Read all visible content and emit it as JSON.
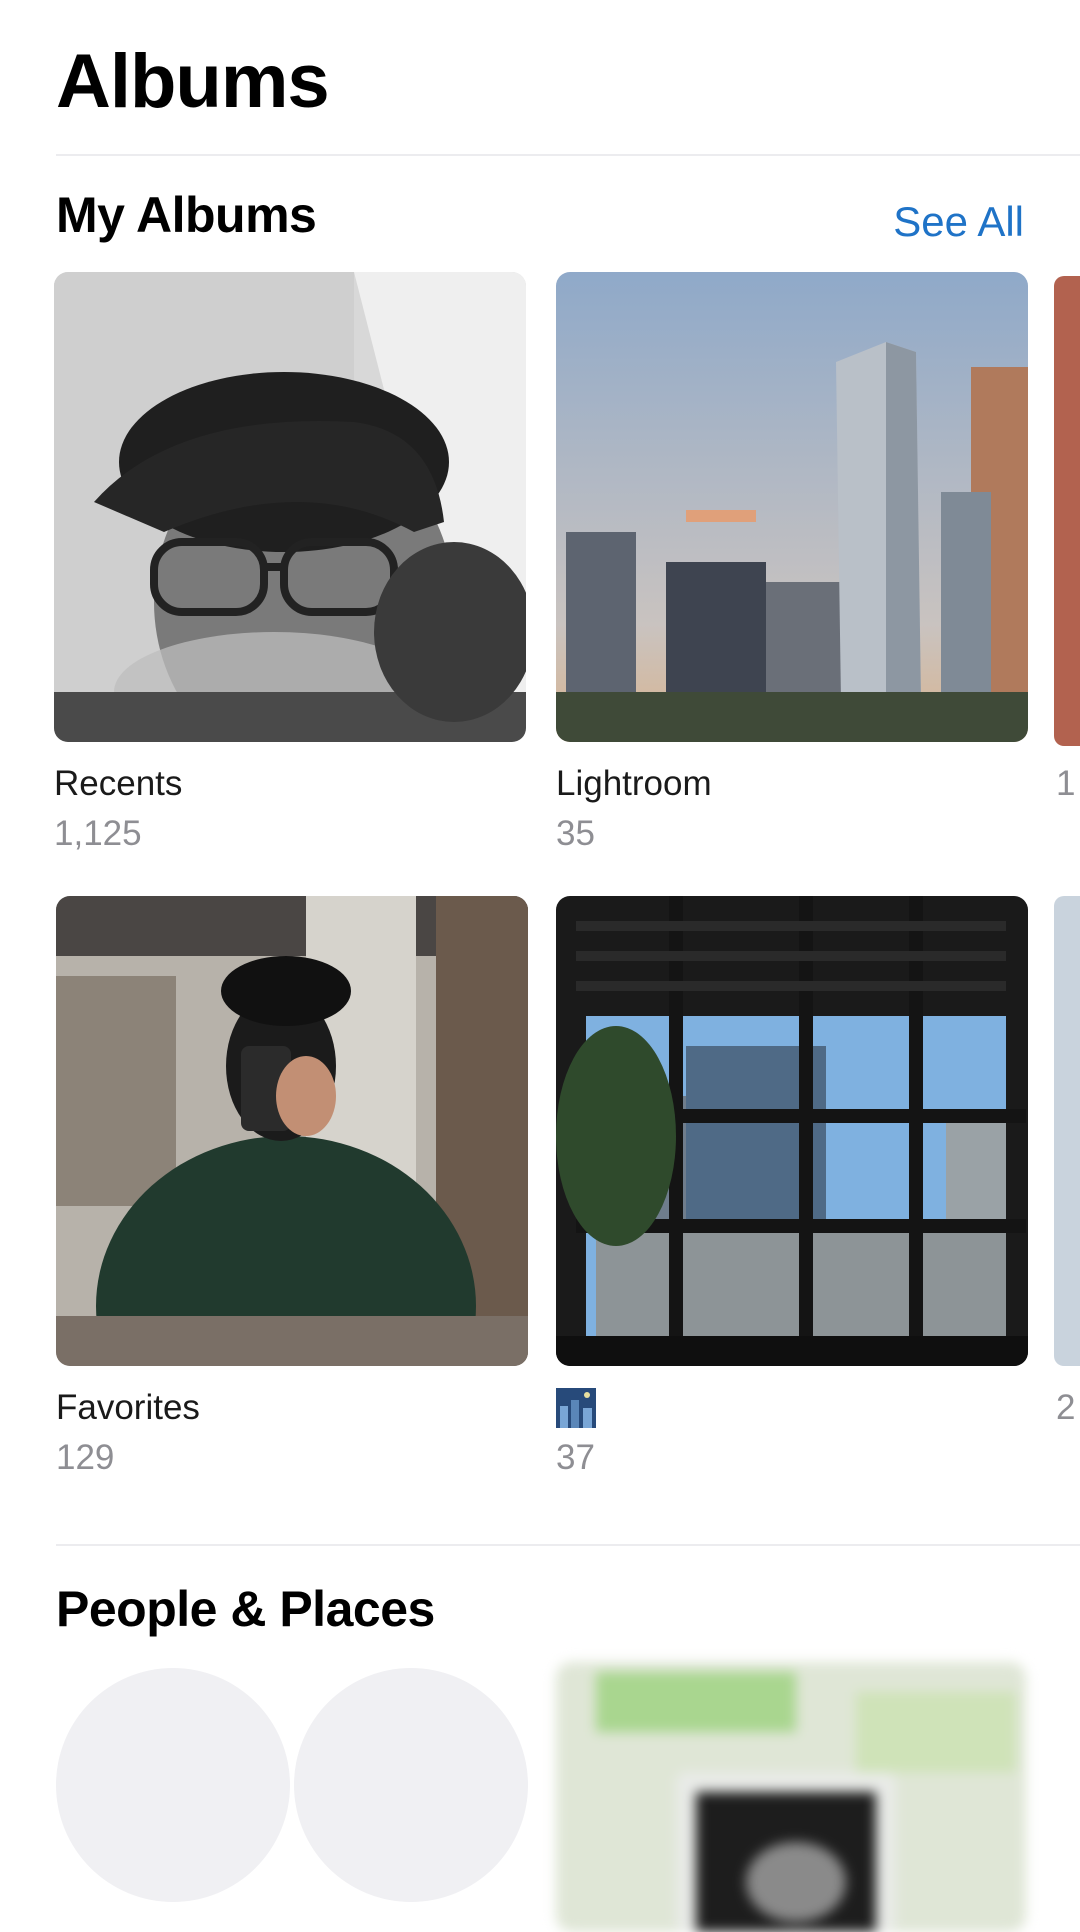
{
  "header": {
    "title": "Albums"
  },
  "my_albums": {
    "section_title": "My Albums",
    "see_all_label": "See All",
    "albums": [
      {
        "name": "Recents",
        "count": "1,125",
        "thumb_icon": "portrait-photo"
      },
      {
        "name": "Lightroom",
        "count": "35",
        "thumb_icon": "city-skyline-photo"
      },
      {
        "name": "Favorites",
        "count": "129",
        "thumb_icon": "mirror-selfie-photo",
        "badge_icon": "heart-icon"
      },
      {
        "name": "",
        "count": "37",
        "thumb_icon": "window-view-photo",
        "name_icon": "city-night-emoji"
      }
    ],
    "peek_column": [
      {
        "count_partial": "1"
      },
      {
        "count_partial": "2"
      }
    ]
  },
  "people_places": {
    "section_title": "People & Places"
  },
  "colors": {
    "accent": "#1f73c7",
    "secondary_text": "#8e8e93",
    "divider": "#ececef"
  }
}
